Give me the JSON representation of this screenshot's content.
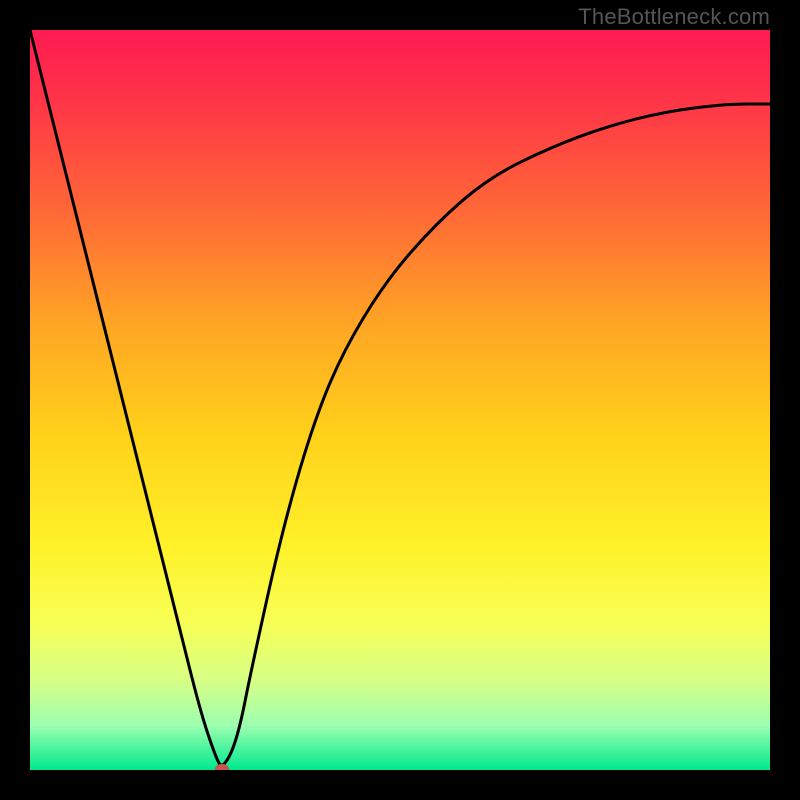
{
  "watermark": "TheBottleneck.com",
  "colors": {
    "frame": "#000000",
    "curve": "#000000",
    "marker": "#cc5449",
    "gradient_stops": [
      {
        "offset": 0.0,
        "color": "#ff1a53"
      },
      {
        "offset": 0.1,
        "color": "#ff3647"
      },
      {
        "offset": 0.25,
        "color": "#ff6a36"
      },
      {
        "offset": 0.4,
        "color": "#ffa624"
      },
      {
        "offset": 0.55,
        "color": "#ffd21a"
      },
      {
        "offset": 0.7,
        "color": "#fff22a"
      },
      {
        "offset": 0.8,
        "color": "#f8ff55"
      },
      {
        "offset": 0.88,
        "color": "#d6ff86"
      },
      {
        "offset": 0.94,
        "color": "#9cffb0"
      },
      {
        "offset": 1.0,
        "color": "#00e98e"
      }
    ]
  },
  "chart_data": {
    "type": "line",
    "title": "",
    "xlabel": "",
    "ylabel": "",
    "xlim": [
      0,
      100
    ],
    "ylim": [
      0,
      100
    ],
    "series": [
      {
        "name": "curve",
        "x": [
          0,
          5,
          10,
          15,
          20,
          23,
          25,
          26,
          28,
          30,
          34,
          38,
          42,
          48,
          55,
          62,
          70,
          78,
          86,
          94,
          100
        ],
        "y": [
          100,
          80,
          60,
          40,
          20,
          8,
          2,
          0,
          4,
          14,
          32,
          46,
          56,
          66,
          74,
          80,
          84,
          87,
          89,
          90,
          90
        ]
      }
    ],
    "annotations": [
      {
        "name": "marker",
        "x": 26,
        "y": 0
      }
    ]
  }
}
